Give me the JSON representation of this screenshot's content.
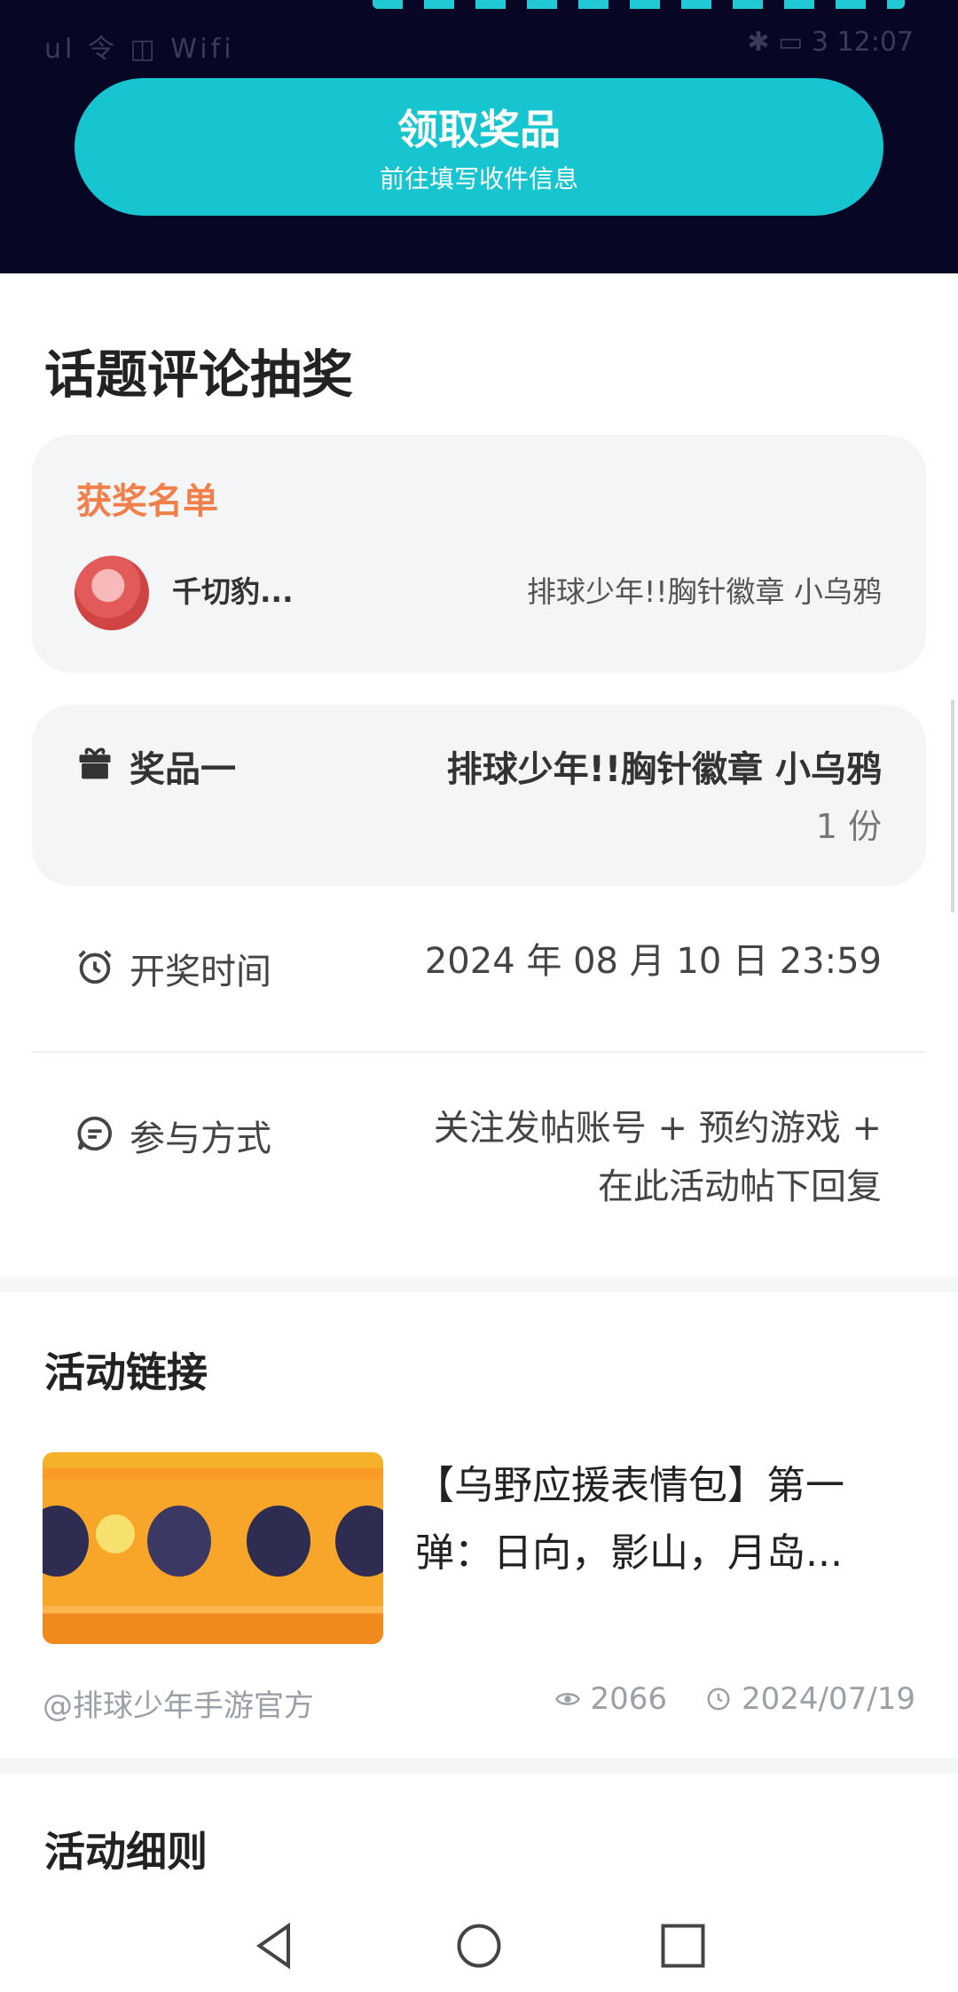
{
  "status": {
    "left": "ul 令 ◫ Wifi",
    "right": "✱ ▭ 3 12:07"
  },
  "banner": {
    "title": "领取奖品",
    "subtitle": "前往填写收件信息"
  },
  "lottery": {
    "title": "话题评论抽奖"
  },
  "winners": {
    "label": "获奖名单",
    "items": [
      {
        "name": "千切豹...",
        "prize": "排球少年!!胸针徽章 小乌鸦"
      }
    ]
  },
  "prize": {
    "label": "奖品一",
    "name": "排球少年!!胸针徽章 小乌鸦",
    "count": "1 份"
  },
  "draw_time": {
    "label": "开奖时间",
    "value": "2024 年 08 月 10 日 23:59"
  },
  "participation": {
    "label": "参与方式",
    "line1": "关注发帖账号 + 预约游戏 +",
    "line2": "在此活动帖下回复"
  },
  "activity_link": {
    "title": "活动链接",
    "article_title": "【乌野应援表情包】第一弹：日向，影山，月岛...",
    "author": "@排球少年手游官方",
    "views": "2066",
    "date": "2024/07/19"
  },
  "rules": {
    "title": "活动细则"
  },
  "icons": {
    "gift": "gift-icon",
    "alarm": "alarm-clock-icon",
    "chat": "chat-bubble-icon",
    "eye": "eye-icon",
    "clock": "clock-icon",
    "back": "nav-back-icon",
    "home": "nav-home-icon",
    "recents": "nav-recents-icon"
  },
  "colors": {
    "banner_bg": "#070625",
    "accent": "#16c5cf",
    "winners_label": "#f07f4a"
  }
}
